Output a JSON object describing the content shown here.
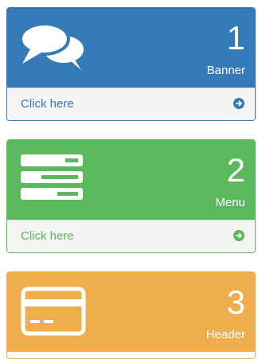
{
  "panels": [
    {
      "id": "banner",
      "number": "1",
      "label": "Banner",
      "link_text": "Click here",
      "icon": "comments-icon",
      "color": "#337ab7"
    },
    {
      "id": "menu",
      "number": "2",
      "label": "Menu",
      "link_text": "Click here",
      "icon": "menu-stack-icon",
      "color": "#5cb85c"
    },
    {
      "id": "header",
      "number": "3",
      "label": "Header",
      "icon": "credit-card-icon",
      "color": "#f0ad4e"
    }
  ],
  "footer_icon": "arrow-circle-right-icon"
}
